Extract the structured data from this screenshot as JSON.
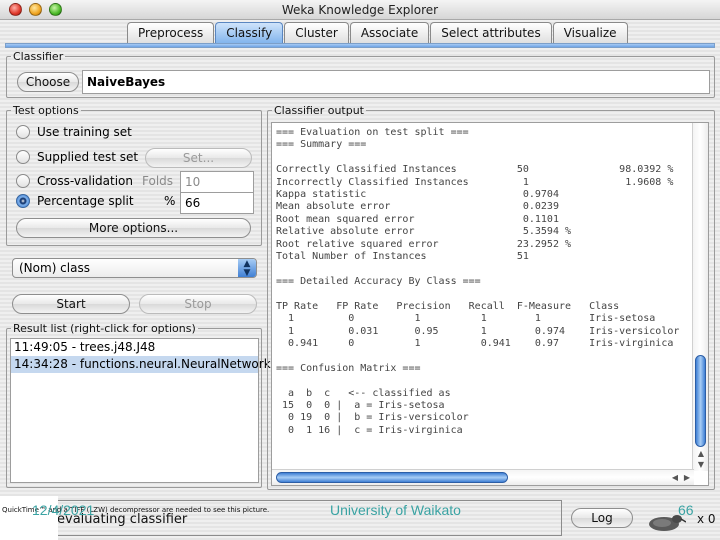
{
  "window": {
    "title": "Weka Knowledge Explorer"
  },
  "tabs": [
    {
      "label": "Preprocess",
      "active": false
    },
    {
      "label": "Classify",
      "active": true
    },
    {
      "label": "Cluster",
      "active": false
    },
    {
      "label": "Associate",
      "active": false
    },
    {
      "label": "Select attributes",
      "active": false
    },
    {
      "label": "Visualize",
      "active": false
    }
  ],
  "classifier": {
    "legend": "Classifier",
    "choose_label": "Choose",
    "value": "NaiveBayes"
  },
  "test_options": {
    "legend": "Test options",
    "use_training_set": "Use training set",
    "supplied_test_set": "Supplied test set",
    "set_button": "Set...",
    "cross_validation": "Cross-validation",
    "folds_label": "Folds",
    "folds_value": "10",
    "percentage_split": "Percentage split",
    "percent_label": "%",
    "percent_value": "66",
    "selected": "percentage_split",
    "more_options": "More options..."
  },
  "class_select": {
    "value": "(Nom) class"
  },
  "actions": {
    "start": "Start",
    "stop": "Stop"
  },
  "result_list": {
    "legend": "Result list (right-click for options)",
    "items": [
      {
        "label": "11:49:05 - trees.j48.J48",
        "selected": false
      },
      {
        "label": "14:34:28 - functions.neural.NeuralNetwork",
        "selected": true
      }
    ]
  },
  "output": {
    "legend": "Classifier output",
    "lines": [
      "=== Evaluation on test split ===",
      "=== Summary ===",
      "",
      "Correctly Classified Instances          50               98.0392 %",
      "Incorrectly Classified Instances         1                1.9608 %",
      "Kappa statistic                          0.9704",
      "Mean absolute error                      0.0239",
      "Root mean squared error                  0.1101",
      "Relative absolute error                  5.3594 %",
      "Root relative squared error             23.2952 %",
      "Total Number of Instances               51",
      "",
      "=== Detailed Accuracy By Class ===",
      "",
      "TP Rate   FP Rate   Precision   Recall  F-Measure   Class",
      "  1         0          1          1        1        Iris-setosa",
      "  1         0.031      0.95       1        0.974    Iris-versicolor",
      "  0.941     0          1          0.941    0.97     Iris-virginica",
      "",
      "=== Confusion Matrix ===",
      "",
      "  a  b  c   <-- classified as",
      " 15  0  0 |  a = Iris-setosa",
      "  0 19  0 |  b = Iris-versicolor",
      "  0  1 16 |  c = Iris-virginica"
    ]
  },
  "status": {
    "text": "evaluating classifier",
    "log_button": "Log",
    "x_count": "x 0"
  },
  "overlay": {
    "quicktime_notice": "QuickTime™ and a TIFF (LZW) decompressor are needed to see this picture.",
    "date": "12/4/2021",
    "university": "University of Waikato",
    "page_number": "66"
  },
  "colors": {
    "accent_blue": "#6ea4e6",
    "selection": "#c5d8ef",
    "footer_teal": "#3aa3a3"
  }
}
